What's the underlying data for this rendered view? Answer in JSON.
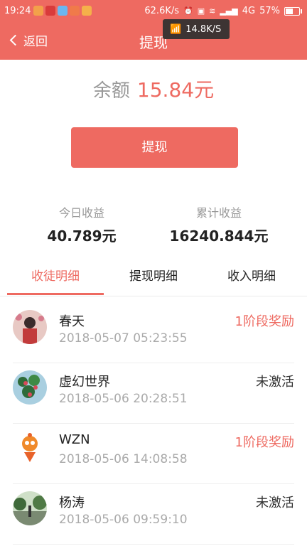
{
  "status_bar": {
    "time": "19:24",
    "speed": "62.6K/s",
    "network": "4G",
    "battery": "57%"
  },
  "net_overlay": {
    "speed": "14.8K/S"
  },
  "nav": {
    "back_label": "返回",
    "title": "提现"
  },
  "balance": {
    "label": "余额",
    "amount": "15.84元"
  },
  "withdraw_button": {
    "label": "提现"
  },
  "stats": {
    "today": {
      "label": "今日收益",
      "value": "40.789元"
    },
    "total": {
      "label": "累计收益",
      "value": "16240.844元"
    }
  },
  "tabs": [
    {
      "label": "收徒明细",
      "active": true
    },
    {
      "label": "提现明细",
      "active": false
    },
    {
      "label": "收入明细",
      "active": false
    }
  ],
  "records": [
    {
      "name": "春天",
      "date": "2018-05-07 05:23:55",
      "status": "1阶段奖励",
      "status_type": "reward"
    },
    {
      "name": "虚幻世界",
      "date": "2018-05-06 20:28:51",
      "status": "未激活",
      "status_type": "inactive"
    },
    {
      "name": "WZN",
      "date": "2018-05-06 14:08:58",
      "status": "1阶段奖励",
      "status_type": "reward"
    },
    {
      "name": "杨涛",
      "date": "2018-05-06 09:59:10",
      "status": "未激活",
      "status_type": "inactive"
    }
  ],
  "colors": {
    "accent": "#ee6a61",
    "muted": "#999999"
  }
}
